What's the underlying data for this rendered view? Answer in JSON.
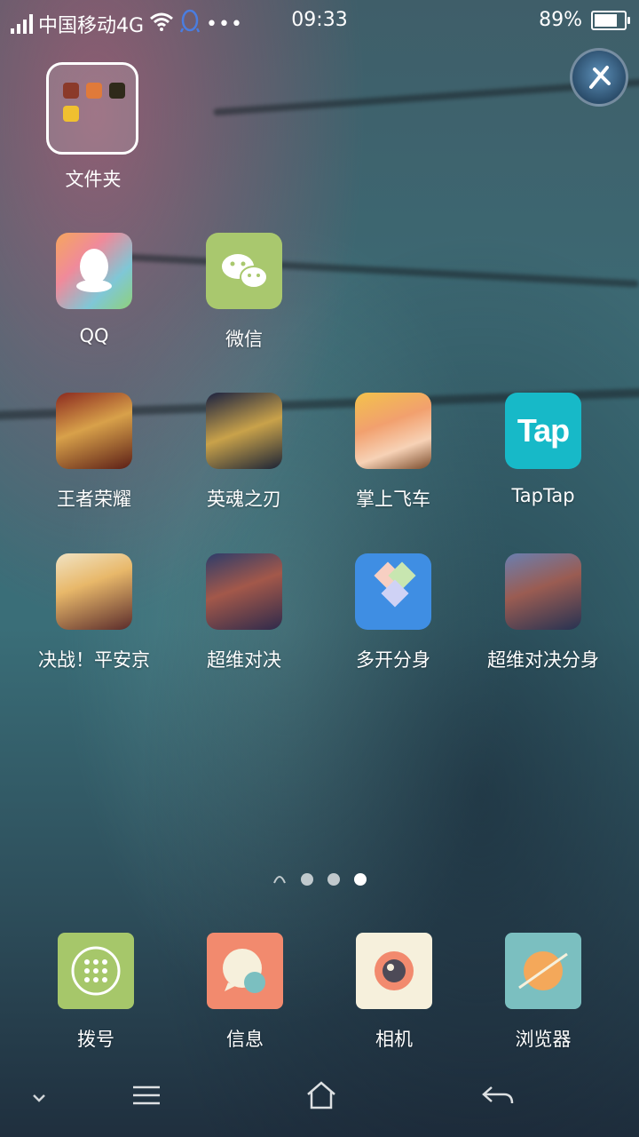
{
  "status_bar": {
    "carrier": "中国移动4G",
    "time": "09:33",
    "battery": "89%",
    "battery_level": 0.89
  },
  "folder": {
    "label": "文件夹"
  },
  "apps": [
    {
      "id": "qq",
      "label": "QQ"
    },
    {
      "id": "wechat",
      "label": "微信"
    },
    {
      "id": "wangzhe",
      "label": "王者荣耀"
    },
    {
      "id": "yinghun",
      "label": "英魂之刃"
    },
    {
      "id": "feiche",
      "label": "掌上飞车"
    },
    {
      "id": "taptap",
      "label": "TapTap",
      "icon_text": "Tap"
    },
    {
      "id": "pingan",
      "label": "决战！平安京"
    },
    {
      "id": "chaowei",
      "label": "超维对决"
    },
    {
      "id": "duokai",
      "label": "多开分身"
    },
    {
      "id": "chaowei2",
      "label": "超维对决分身"
    }
  ],
  "page_indicator": {
    "pages": 3,
    "active": 3
  },
  "dock": [
    {
      "id": "dialer",
      "label": "拨号"
    },
    {
      "id": "messages",
      "label": "信息"
    },
    {
      "id": "camera",
      "label": "相机"
    },
    {
      "id": "browser",
      "label": "浏览器"
    }
  ],
  "icons": {
    "signal": "signal-icon",
    "wifi": "wifi-icon",
    "qq_notify": "qq-notification-icon",
    "more": "more-dots-icon",
    "battery": "battery-icon",
    "float_ball": "floating-assistant-icon",
    "home_page": "home-page-icon",
    "nav_collapse": "chevron-down-icon",
    "nav_menu": "menu-icon",
    "nav_home": "home-icon",
    "nav_back": "back-icon"
  }
}
